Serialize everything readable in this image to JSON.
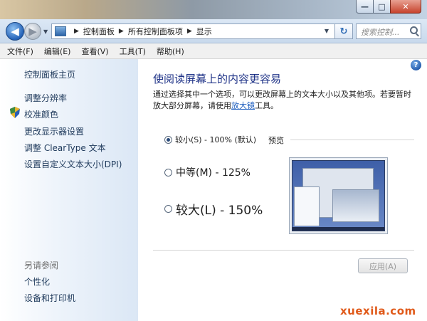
{
  "navigation": {
    "breadcrumbs": [
      "控制面板",
      "所有控制面板项",
      "显示"
    ],
    "search_placeholder": "搜索控制..."
  },
  "window_controls": {
    "minimize": "—",
    "maximize": "□",
    "close": "✕"
  },
  "menu": [
    "文件(F)",
    "编辑(E)",
    "查看(V)",
    "工具(T)",
    "帮助(H)"
  ],
  "sidebar": {
    "home": "控制面板主页",
    "links": [
      "调整分辨率",
      "校准颜色",
      "更改显示器设置",
      "调整 ClearType 文本",
      "设置自定义文本大小(DPI)"
    ],
    "see_also_header": "另请参阅",
    "see_also": [
      "个性化",
      "设备和打印机"
    ]
  },
  "main": {
    "title": "使阅读屏幕上的内容更容易",
    "description_prefix": "通过选择其中一个选项，可以更改屏幕上的文本大小以及其他项。若要暂时放大部分屏幕，请使用",
    "magnifier_link": "放大镜",
    "description_suffix": "工具。",
    "options": [
      {
        "label": "较小(S) - 100% (默认)",
        "checked": true
      },
      {
        "label": "中等(M) - 125%",
        "checked": false
      },
      {
        "label": "较大(L) - 150%",
        "checked": false
      }
    ],
    "preview_label": "预览",
    "apply_label": "应用(A)"
  },
  "icons": {
    "back": "◀",
    "forward": "▶",
    "dropdown": "▼",
    "refresh": "↻",
    "help": "?"
  },
  "watermark": "xuexila.com",
  "colors": {
    "title_blue": "#1e3287",
    "link_blue": "#1f5fbf",
    "sidebar_link": "#1e395b",
    "watermark": "#e05a1a"
  }
}
